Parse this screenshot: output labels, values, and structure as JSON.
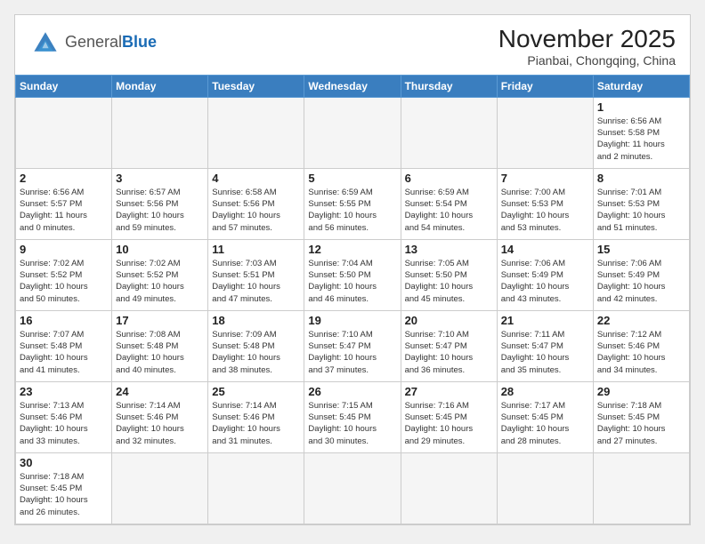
{
  "header": {
    "logo_general": "General",
    "logo_blue": "Blue",
    "title": "November 2025",
    "subtitle": "Pianbai, Chongqing, China"
  },
  "weekdays": [
    "Sunday",
    "Monday",
    "Tuesday",
    "Wednesday",
    "Thursday",
    "Friday",
    "Saturday"
  ],
  "weeks": [
    [
      {
        "day": "",
        "info": ""
      },
      {
        "day": "",
        "info": ""
      },
      {
        "day": "",
        "info": ""
      },
      {
        "day": "",
        "info": ""
      },
      {
        "day": "",
        "info": ""
      },
      {
        "day": "",
        "info": ""
      },
      {
        "day": "1",
        "info": "Sunrise: 6:56 AM\nSunset: 5:58 PM\nDaylight: 11 hours\nand 2 minutes."
      }
    ],
    [
      {
        "day": "2",
        "info": "Sunrise: 6:56 AM\nSunset: 5:57 PM\nDaylight: 11 hours\nand 0 minutes."
      },
      {
        "day": "3",
        "info": "Sunrise: 6:57 AM\nSunset: 5:56 PM\nDaylight: 10 hours\nand 59 minutes."
      },
      {
        "day": "4",
        "info": "Sunrise: 6:58 AM\nSunset: 5:56 PM\nDaylight: 10 hours\nand 57 minutes."
      },
      {
        "day": "5",
        "info": "Sunrise: 6:59 AM\nSunset: 5:55 PM\nDaylight: 10 hours\nand 56 minutes."
      },
      {
        "day": "6",
        "info": "Sunrise: 6:59 AM\nSunset: 5:54 PM\nDaylight: 10 hours\nand 54 minutes."
      },
      {
        "day": "7",
        "info": "Sunrise: 7:00 AM\nSunset: 5:53 PM\nDaylight: 10 hours\nand 53 minutes."
      },
      {
        "day": "8",
        "info": "Sunrise: 7:01 AM\nSunset: 5:53 PM\nDaylight: 10 hours\nand 51 minutes."
      }
    ],
    [
      {
        "day": "9",
        "info": "Sunrise: 7:02 AM\nSunset: 5:52 PM\nDaylight: 10 hours\nand 50 minutes."
      },
      {
        "day": "10",
        "info": "Sunrise: 7:02 AM\nSunset: 5:52 PM\nDaylight: 10 hours\nand 49 minutes."
      },
      {
        "day": "11",
        "info": "Sunrise: 7:03 AM\nSunset: 5:51 PM\nDaylight: 10 hours\nand 47 minutes."
      },
      {
        "day": "12",
        "info": "Sunrise: 7:04 AM\nSunset: 5:50 PM\nDaylight: 10 hours\nand 46 minutes."
      },
      {
        "day": "13",
        "info": "Sunrise: 7:05 AM\nSunset: 5:50 PM\nDaylight: 10 hours\nand 45 minutes."
      },
      {
        "day": "14",
        "info": "Sunrise: 7:06 AM\nSunset: 5:49 PM\nDaylight: 10 hours\nand 43 minutes."
      },
      {
        "day": "15",
        "info": "Sunrise: 7:06 AM\nSunset: 5:49 PM\nDaylight: 10 hours\nand 42 minutes."
      }
    ],
    [
      {
        "day": "16",
        "info": "Sunrise: 7:07 AM\nSunset: 5:48 PM\nDaylight: 10 hours\nand 41 minutes."
      },
      {
        "day": "17",
        "info": "Sunrise: 7:08 AM\nSunset: 5:48 PM\nDaylight: 10 hours\nand 40 minutes."
      },
      {
        "day": "18",
        "info": "Sunrise: 7:09 AM\nSunset: 5:48 PM\nDaylight: 10 hours\nand 38 minutes."
      },
      {
        "day": "19",
        "info": "Sunrise: 7:10 AM\nSunset: 5:47 PM\nDaylight: 10 hours\nand 37 minutes."
      },
      {
        "day": "20",
        "info": "Sunrise: 7:10 AM\nSunset: 5:47 PM\nDaylight: 10 hours\nand 36 minutes."
      },
      {
        "day": "21",
        "info": "Sunrise: 7:11 AM\nSunset: 5:47 PM\nDaylight: 10 hours\nand 35 minutes."
      },
      {
        "day": "22",
        "info": "Sunrise: 7:12 AM\nSunset: 5:46 PM\nDaylight: 10 hours\nand 34 minutes."
      }
    ],
    [
      {
        "day": "23",
        "info": "Sunrise: 7:13 AM\nSunset: 5:46 PM\nDaylight: 10 hours\nand 33 minutes."
      },
      {
        "day": "24",
        "info": "Sunrise: 7:14 AM\nSunset: 5:46 PM\nDaylight: 10 hours\nand 32 minutes."
      },
      {
        "day": "25",
        "info": "Sunrise: 7:14 AM\nSunset: 5:46 PM\nDaylight: 10 hours\nand 31 minutes."
      },
      {
        "day": "26",
        "info": "Sunrise: 7:15 AM\nSunset: 5:45 PM\nDaylight: 10 hours\nand 30 minutes."
      },
      {
        "day": "27",
        "info": "Sunrise: 7:16 AM\nSunset: 5:45 PM\nDaylight: 10 hours\nand 29 minutes."
      },
      {
        "day": "28",
        "info": "Sunrise: 7:17 AM\nSunset: 5:45 PM\nDaylight: 10 hours\nand 28 minutes."
      },
      {
        "day": "29",
        "info": "Sunrise: 7:18 AM\nSunset: 5:45 PM\nDaylight: 10 hours\nand 27 minutes."
      }
    ],
    [
      {
        "day": "30",
        "info": "Sunrise: 7:18 AM\nSunset: 5:45 PM\nDaylight: 10 hours\nand 26 minutes."
      },
      {
        "day": "",
        "info": ""
      },
      {
        "day": "",
        "info": ""
      },
      {
        "day": "",
        "info": ""
      },
      {
        "day": "",
        "info": ""
      },
      {
        "day": "",
        "info": ""
      },
      {
        "day": "",
        "info": ""
      }
    ]
  ]
}
